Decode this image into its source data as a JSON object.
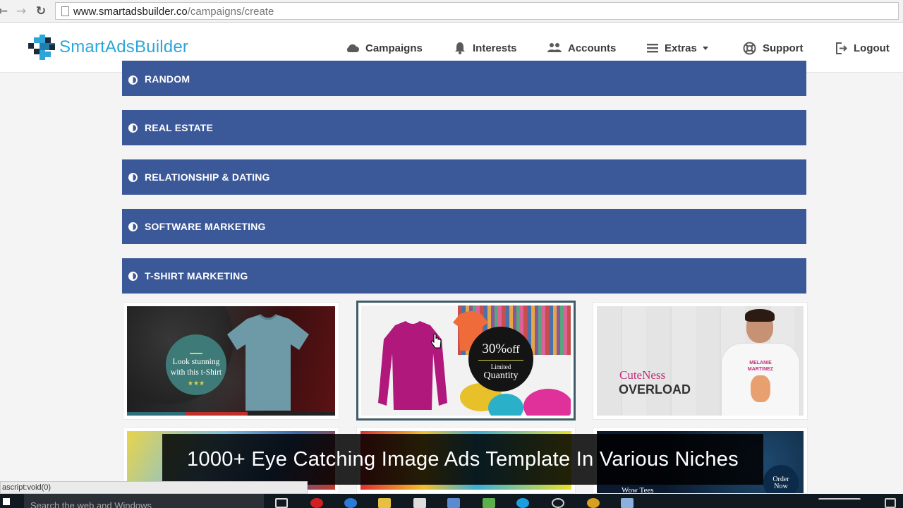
{
  "browser": {
    "url_domain": "www.smartadsbuilder.co",
    "url_path": "/campaigns/create",
    "back_glyph": "←",
    "forward_glyph": "→",
    "reload_glyph": "↻"
  },
  "header": {
    "logo_text": "SmartAdsBuilder",
    "nav": [
      {
        "label": "Campaigns",
        "icon": "cloud-icon"
      },
      {
        "label": "Interests",
        "icon": "bell-icon"
      },
      {
        "label": "Accounts",
        "icon": "users-icon"
      },
      {
        "label": "Extras",
        "icon": "menu-icon"
      },
      {
        "label": "Support",
        "icon": "lifebuoy-icon"
      },
      {
        "label": "Logout",
        "icon": "logout-icon"
      }
    ]
  },
  "categories": [
    {
      "label": "RANDOM"
    },
    {
      "label": "REAL ESTATE"
    },
    {
      "label": "RELATIONSHIP & DATING"
    },
    {
      "label": "SOFTWARE MARKETING"
    },
    {
      "label": "T-SHIRT MARKETING"
    }
  ],
  "templates": [
    {
      "line1": "Look stunning",
      "line2": "with this t-Shirt",
      "stars": "★★★"
    },
    {
      "big": "30%",
      "off": "off",
      "small": "Limited",
      "sub": "Quantity"
    },
    {
      "brand": "CuteNess",
      "word": "OVERLOAD",
      "shirt_l1": "MELANIE",
      "shirt_l2": "MARTINEZ"
    }
  ],
  "partial_templates": {
    "wow": "Wow Tees",
    "order_l1": "Order",
    "order_l2": "Now"
  },
  "caption": "1000+ Eye Catching Image Ads Template In Various Niches",
  "status_text": "ascript:void(0)",
  "taskbar": {
    "search_placeholder": "Search the web and Windows"
  },
  "colors": {
    "category_bar": "#3b5898",
    "logo": "#2ca6d8",
    "selected_border": "#3f5c68"
  }
}
